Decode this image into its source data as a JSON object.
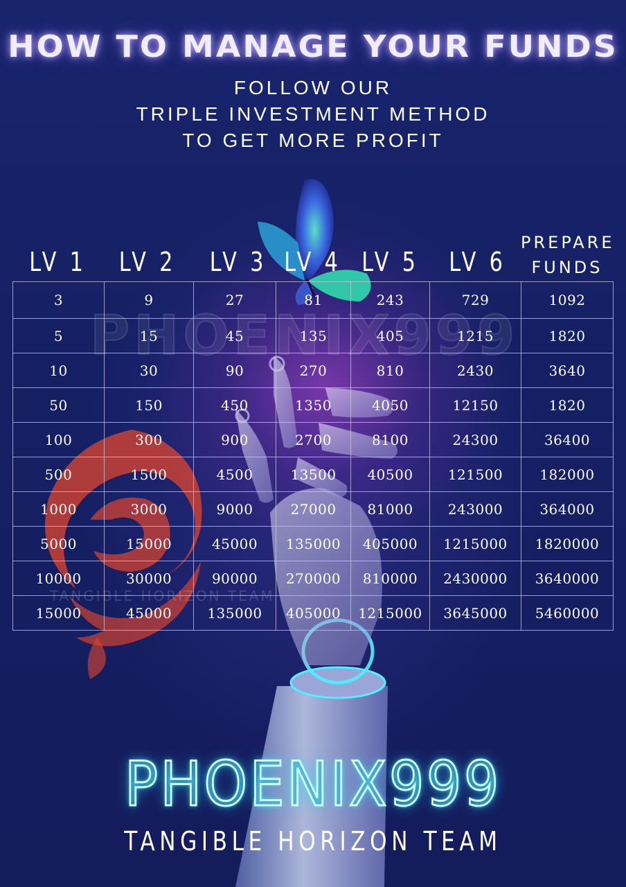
{
  "header": {
    "title": "HOW TO MANAGE YOUR FUNDS",
    "subtitle_lines": [
      "FOLLOW OUR",
      "TRIPLE INVESTMENT METHOD",
      "TO GET MORE PROFIT"
    ]
  },
  "table": {
    "columns": [
      "LV 1",
      "LV 2",
      "LV 3",
      "LV 4",
      "LV 5",
      "LV 6"
    ],
    "prepare_header": [
      "PREPARE",
      "FUNDS"
    ],
    "rows": [
      [
        "3",
        "9",
        "27",
        "81",
        "243",
        "729",
        "1092"
      ],
      [
        "5",
        "15",
        "45",
        "135",
        "405",
        "1215",
        "1820"
      ],
      [
        "10",
        "30",
        "90",
        "270",
        "810",
        "2430",
        "3640"
      ],
      [
        "50",
        "150",
        "450",
        "1350",
        "4050",
        "12150",
        "1820"
      ],
      [
        "100",
        "300",
        "900",
        "2700",
        "8100",
        "24300",
        "36400"
      ],
      [
        "500",
        "1500",
        "4500",
        "13500",
        "40500",
        "121500",
        "182000"
      ],
      [
        "1000",
        "3000",
        "9000",
        "27000",
        "81000",
        "243000",
        "364000"
      ],
      [
        "5000",
        "15000",
        "45000",
        "135000",
        "405000",
        "1215000",
        "1820000"
      ],
      [
        "10000",
        "30000",
        "90000",
        "270000",
        "810000",
        "2430000",
        "3640000"
      ],
      [
        "15000",
        "45000",
        "135000",
        "405000",
        "1215000",
        "3645000",
        "5460000"
      ]
    ]
  },
  "watermark": {
    "text": "PHOENIX999",
    "team": "TANGIBLE HORIZON TEAM"
  },
  "footer": {
    "brand": "PHOENIX999",
    "team": "TANGIBLE HORIZON TEAM"
  },
  "colors": {
    "background": "#16216a",
    "neon": "#5ff0ff",
    "glow": "#c04ad8",
    "phoenix_red": "#d8402a"
  }
}
